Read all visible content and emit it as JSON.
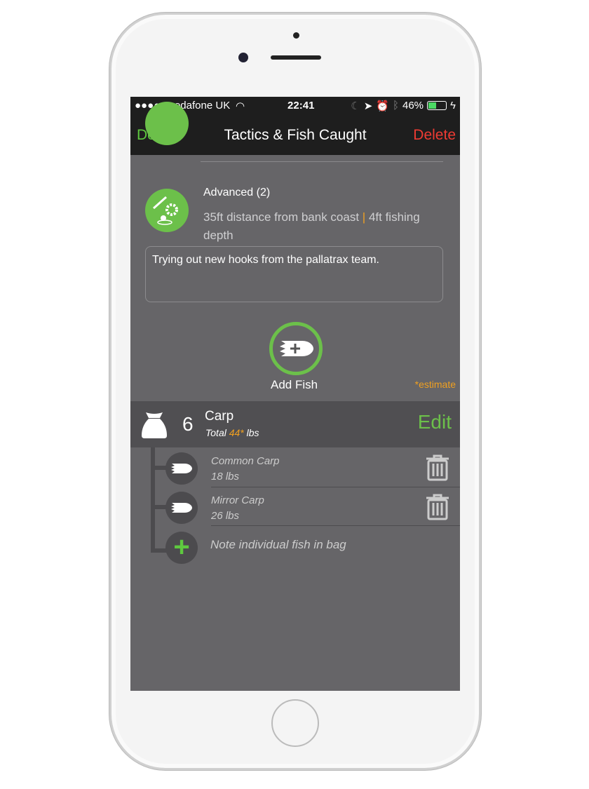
{
  "status": {
    "carrier": "●●●●● vodafone UK",
    "time": "22:41",
    "battery": "46%"
  },
  "nav": {
    "done": "Done",
    "title": "Tactics & Fish Caught",
    "delete": "Delete"
  },
  "advanced": {
    "title": "Advanced (2)",
    "detail_a": "35ft distance from bank coast",
    "divider": "|",
    "detail_b": "4ft fishing",
    "detail_c": "depth"
  },
  "note": "Trying out new hooks from the pallatrax team.",
  "add_fish": "Add Fish",
  "estimate": "*estimate",
  "bag": {
    "count": "6",
    "species": "Carp",
    "total_prefix": "Total",
    "total_value": "44*",
    "total_unit": "lbs",
    "edit": "Edit"
  },
  "fish": [
    {
      "name": "Common Carp",
      "weight": "18 lbs"
    },
    {
      "name": "Mirror Carp",
      "weight": "26 lbs"
    }
  ],
  "add_individual": "Note individual fish in bag",
  "colors": {
    "green": "#6cc04a",
    "red": "#ee3b33",
    "orange": "#f0a020",
    "bg": "#666568"
  }
}
